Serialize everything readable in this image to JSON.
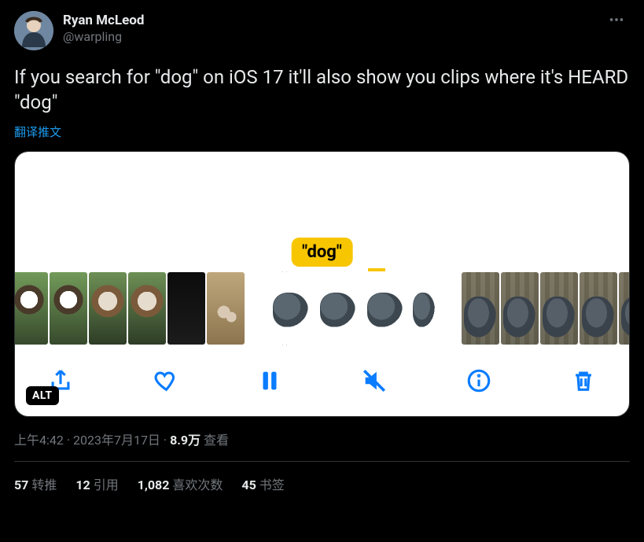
{
  "author": {
    "display_name": "Ryan McLeod",
    "handle": "@warpling"
  },
  "tweet_text": "If you search for \"dog\" on iOS 17 it'll also show you clips where it's HEARD \"dog\"",
  "translate_label": "翻译推文",
  "media": {
    "search_token": "\"dog\"",
    "alt_badge": "ALT",
    "toolbar_icons": [
      "share-icon",
      "heart-icon",
      "pause-icon",
      "mute-icon",
      "info-icon",
      "trash-icon"
    ]
  },
  "meta": {
    "time": "上午4:42",
    "date": "2023年7月17日",
    "views_number": "8.9万",
    "views_label": "查看",
    "separator": " · "
  },
  "stats": {
    "retweets": {
      "count": "57",
      "label": "转推"
    },
    "quotes": {
      "count": "12",
      "label": "引用"
    },
    "likes": {
      "count": "1,082",
      "label": "喜欢次数"
    },
    "bookmarks": {
      "count": "45",
      "label": "书签"
    }
  }
}
